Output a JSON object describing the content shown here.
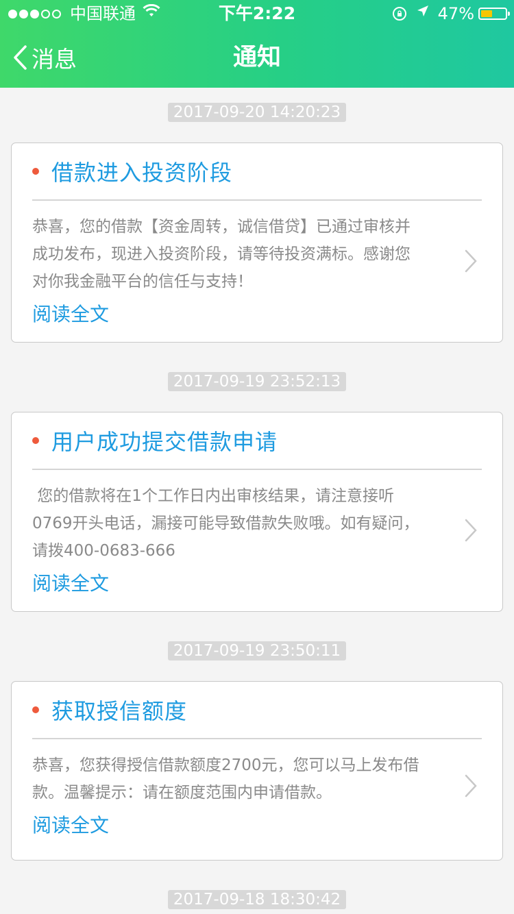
{
  "status_bar": {
    "carrier": "中国联通",
    "time": "下午2:22",
    "battery": "47%",
    "battery_level": 0.47
  },
  "nav": {
    "back_label": "消息",
    "title": "通知"
  },
  "items": [
    {
      "timestamp": "2017-09-20 14:20:23",
      "title": "借款进入投资阶段",
      "body_lines": [
        "恭喜，您的借款【资金周转，诚信借贷】已通过审核并",
        "成功发布，现进入投资阶段，请等待投资满标。感谢您",
        "对你我金融平台的信任与支持！"
      ],
      "link": "阅读全文"
    },
    {
      "timestamp": "2017-09-19 23:52:13",
      "title": "用户成功提交借款申请",
      "body_lines": [
        " 您的借款将在1个工作日内出审核结果，请注意接听",
        "0769开头电话，漏接可能导致借款失败哦。如有疑问，",
        "请拨400-0683-666"
      ],
      "link": "阅读全文"
    },
    {
      "timestamp": "2017-09-19 23:50:11",
      "title": "获取授信额度",
      "body_lines": [
        "恭喜，您获得授信借款额度2700元，您可以马上发布借",
        "款。温馨提示：请在额度范围内申请借款。"
      ],
      "link": "阅读全文"
    },
    {
      "timestamp": "2017-09-18 18:30:42"
    }
  ]
}
